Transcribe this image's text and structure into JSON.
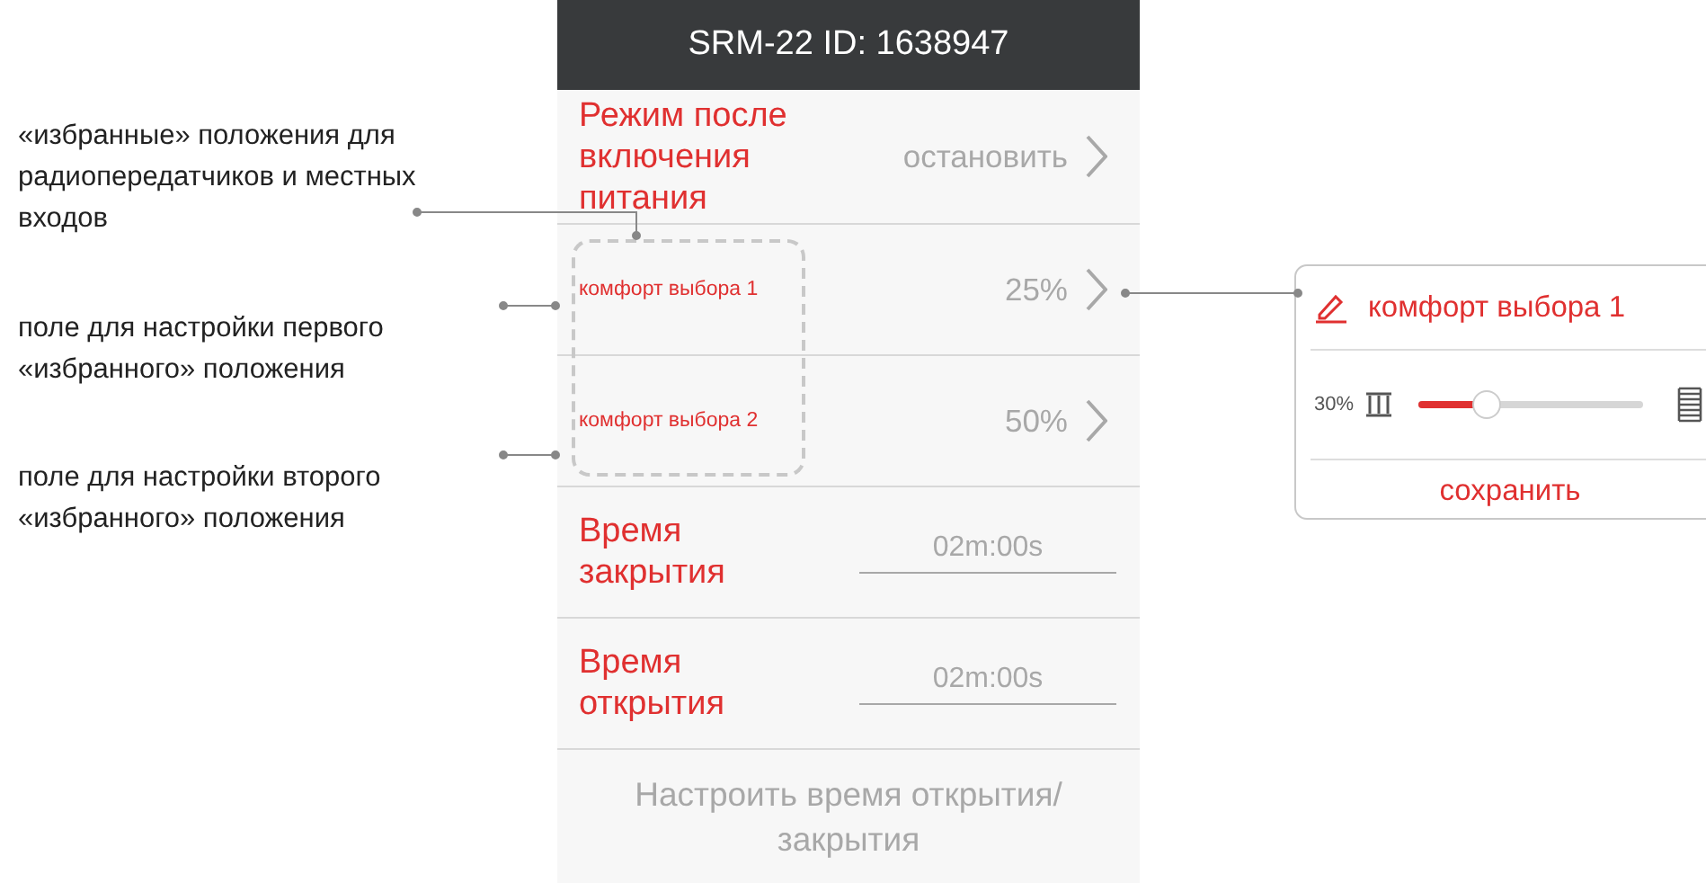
{
  "annotations": [
    {
      "text": "«избранные» положения для радиопередатчиков и местных входов"
    },
    {
      "text": "поле для настройки первого «избранного» положения"
    },
    {
      "text": "поле для настройки второго «избранного» положения"
    }
  ],
  "phone": {
    "title": "SRM-22 ID: 1638947",
    "rows": [
      {
        "kind": "select",
        "label": "Режим после включения питания",
        "value": "остановить"
      },
      {
        "kind": "favorite",
        "label": "комфорт выбора 1",
        "value": "25%"
      },
      {
        "kind": "favorite",
        "label": "комфорт выбора 2",
        "value": "50%"
      },
      {
        "kind": "time",
        "label": "Время закрытия",
        "value": "02m:00s"
      },
      {
        "kind": "time",
        "label": "Время открытия",
        "value": "02m:00s"
      }
    ],
    "footer_button": "Настроить время открытия/ закрытия"
  },
  "popup": {
    "title": "комфорт выбора 1",
    "reading": "30%",
    "level": 0.3,
    "save_button": "сохранить"
  }
}
